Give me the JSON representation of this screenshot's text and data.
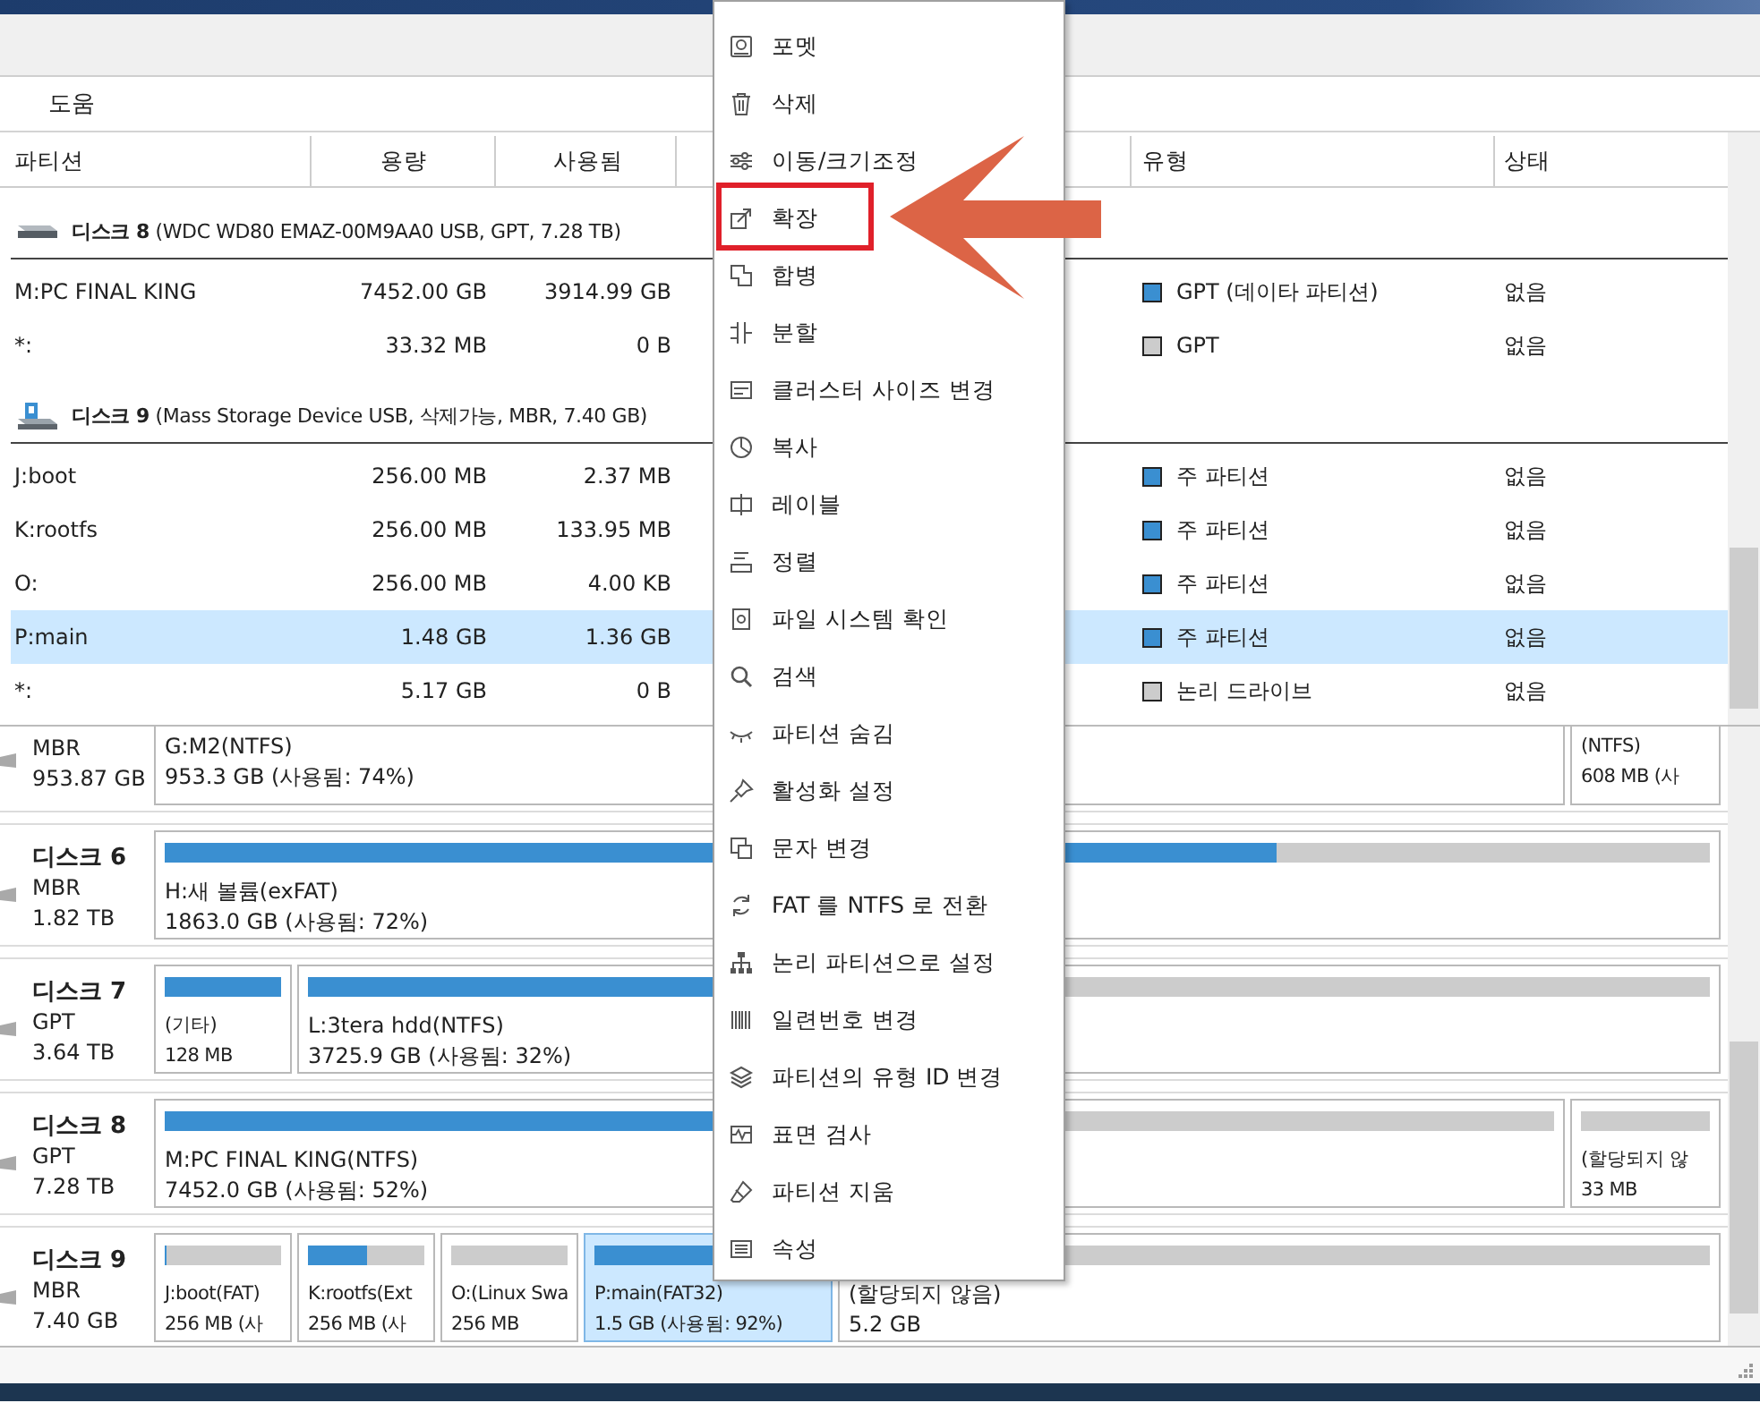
{
  "menubar": {
    "items": [
      "도움"
    ]
  },
  "table": {
    "columns": [
      "파티션",
      "용량",
      "사용됨",
      "유형",
      "상태"
    ],
    "groups": [
      {
        "disk": "**디스크 8** (WDC WD80 EMAZ-00M9AA0 USB, GPT, 7.28 TB)",
        "kind": "hdd",
        "rows": [
          {
            "partition": "M:PC FINAL KING",
            "capacity": "7452.00 GB",
            "used": "3914.99 GB",
            "type": "GPT (데이타 파티션)",
            "color": "#3a8fd1",
            "status": "없음",
            "selected": false
          },
          {
            "partition": "*:",
            "capacity": "33.32 MB",
            "used": "0 B",
            "type": "GPT",
            "color": "#cccccc",
            "status": "없음",
            "selected": false
          }
        ]
      },
      {
        "disk": "**디스크 9** (Mass Storage Device USB, 삭제가능, MBR, 7.40 GB)",
        "kind": "usb",
        "rows": [
          {
            "partition": "J:boot",
            "capacity": "256.00 MB",
            "used": "2.37 MB",
            "type": "주 파티션",
            "color": "#3a8fd1",
            "status": "없음",
            "selected": false
          },
          {
            "partition": "K:rootfs",
            "capacity": "256.00 MB",
            "used": "133.95 MB",
            "type": "주 파티션",
            "color": "#3a8fd1",
            "status": "없음",
            "selected": false
          },
          {
            "partition": "O:",
            "capacity": "256.00 MB",
            "used": "4.00 KB",
            "type": "주 파티션",
            "color": "#3a8fd1",
            "status": "없음",
            "selected": false
          },
          {
            "partition": "P:main",
            "capacity": "1.48 GB",
            "used": "1.36 GB",
            "type": "주 파티션",
            "color": "#3a8fd1",
            "status": "없음",
            "selected": true
          },
          {
            "partition": "*:",
            "capacity": "5.17 GB",
            "used": "0 B",
            "type": "논리 드라이브",
            "color": "#cccccc",
            "status": "없음",
            "selected": false
          }
        ]
      }
    ]
  },
  "disk_map": {
    "disks": [
      {
        "style": "MBR",
        "size": "953.87 GB",
        "partitions": [
          {
            "label": "G:M2(NTFS)",
            "detail": "953.3 GB (사용됨: 74%)",
            "selected": false
          },
          {
            "label": "(NTFS)",
            "detail": "608 MB (사",
            "selected": false
          }
        ]
      },
      {
        "name": "디스크 6",
        "style": "MBR",
        "size": "1.82 TB",
        "partitions": [
          {
            "label": "H:새 볼륨(exFAT)",
            "detail": "1863.0 GB (사용됨: 72%)",
            "level": 0.72,
            "selected": false
          }
        ]
      },
      {
        "name": "디스크 7",
        "style": "GPT",
        "size": "3.64 TB",
        "partitions": [
          {
            "label": "(기타)",
            "detail": "128 MB",
            "level": 1,
            "selected": false
          },
          {
            "label": "L:3tera hdd(NTFS)",
            "detail": "3725.9 GB (사용됨: 32%)",
            "level": 0.32,
            "selected": false
          }
        ]
      },
      {
        "name": "디스크 8",
        "style": "GPT",
        "size": "7.28 TB",
        "partitions": [
          {
            "label": "M:PC FINAL KING(NTFS)",
            "detail": "7452.0 GB (사용됨: 52%)",
            "level": 0.52,
            "selected": false
          },
          {
            "label": "(할당되지 않",
            "detail": "33 MB",
            "kind": "empty",
            "selected": false
          }
        ]
      },
      {
        "name": "디스크 9",
        "style": "MBR",
        "size": "7.40 GB",
        "partitions": [
          {
            "label": "J:boot(FAT)",
            "detail": "256 MB (사",
            "level": 0.02,
            "selected": false
          },
          {
            "label": "K:rootfs(Ext",
            "detail": "256 MB (사",
            "level": 0.5,
            "selected": false
          },
          {
            "label": "O:(Linux Swa",
            "detail": "256 MB",
            "kind": "empty",
            "selected": false
          },
          {
            "label": "P:main(FAT32)",
            "detail": "1.5 GB (사용됨: 92%)",
            "level": 0.92,
            "selected": true
          },
          {
            "label": "(할당되지 않음)",
            "detail": "5.2 GB",
            "kind": "empty",
            "selected": false
          }
        ]
      }
    ]
  },
  "context_menu": {
    "items": [
      {
        "label": "포멧",
        "highlighted": false
      },
      {
        "label": "삭제",
        "highlighted": false
      },
      {
        "label": "이동/크기조정",
        "highlighted": false
      },
      {
        "label": "확장",
        "highlighted": true
      },
      {
        "label": "합병",
        "highlighted": false
      },
      {
        "label": "분할",
        "highlighted": false
      },
      {
        "label": "클러스터 사이즈 변경",
        "highlighted": false
      },
      {
        "label": "복사",
        "highlighted": false
      },
      {
        "label": "레이블",
        "highlighted": false
      },
      {
        "label": "정렬",
        "highlighted": false
      },
      {
        "label": "파일 시스템 확인",
        "highlighted": false
      },
      {
        "label": "검색",
        "highlighted": false
      },
      {
        "label": "파티션 숨김",
        "highlighted": false
      },
      {
        "label": "활성화 설정",
        "highlighted": false
      },
      {
        "label": "문자 변경",
        "highlighted": false
      },
      {
        "label": "FAT 를 NTFS 로 전환",
        "highlighted": false
      },
      {
        "label": "논리 파티션으로 설정",
        "highlighted": false
      },
      {
        "label": "일련번호 변경",
        "highlighted": false
      },
      {
        "label": "파티션의 유형 ID 변경",
        "highlighted": false
      },
      {
        "label": "표면 검사",
        "highlighted": false
      },
      {
        "label": "파티션 지움",
        "highlighted": false
      },
      {
        "label": "속성",
        "highlighted": false
      }
    ]
  }
}
